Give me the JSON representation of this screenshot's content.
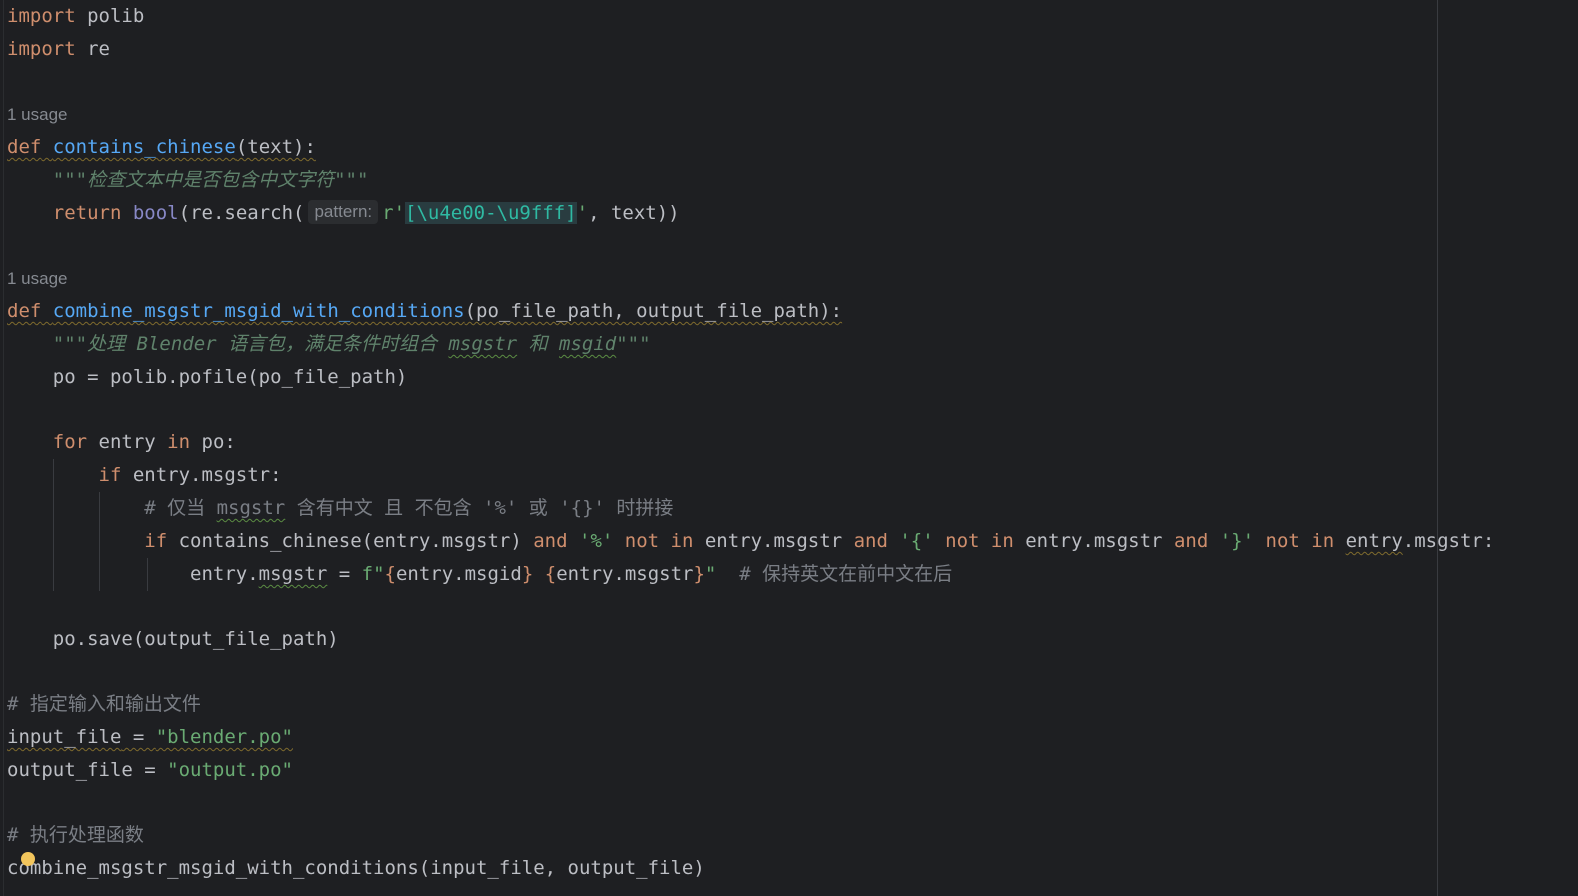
{
  "editor": {
    "lines": {
      "l1": {
        "kw": "import",
        "rest": " polib"
      },
      "l2": {
        "kw": "import",
        "rest": " re"
      },
      "usage1": "1 usage",
      "l5": {
        "kw": "def",
        "name": "contains_chinese",
        "rest": "(text):"
      },
      "l6": {
        "doc": "\"\"\"检查文本中是否包含中文字符\"\"\""
      },
      "l7": {
        "kw": "return",
        "bi": "bool",
        "pre": "(re.search(",
        "hint": "pattern:",
        "str_open": "r'",
        "esc": "[\\u4e00-\\u9fff]",
        "str_close": "'",
        "rest": ", text))"
      },
      "usage2": "1 usage",
      "l10": {
        "kw": "def",
        "name": "combine_msgstr_msgid_with_conditions",
        "rest": "(po_file_path, output_file_path):"
      },
      "l11": {
        "doc_a": "\"\"\"处理 Blender 语言包，满足条件时组合 ",
        "t1": "msgstr",
        "doc_b": " 和 ",
        "t2": "msgid",
        "doc_c": "\"\"\""
      },
      "l12": "po = polib.pofile(po_file_path)",
      "l14": {
        "kw": "for",
        "a": " entry ",
        "kw2": "in",
        "b": " po:"
      },
      "l15": {
        "kw": "if",
        "rest": " entry.msgstr:"
      },
      "l16": {
        "a": "# 仅当 ",
        "t": "msgstr",
        "b": " 含有中文 且 不包含 '%' 或 '{}' 时拼接"
      },
      "l17": {
        "kw": "if",
        "c1": " contains_chinese(entry.msgstr) ",
        "and1": "and",
        "s1": "'%'",
        "notin1": "not in",
        "c2": " entry.msgstr ",
        "and2": "and",
        "s2": "'{'",
        "notin2": "not in",
        "c3": " entry.msgstr ",
        "and3": "and",
        "s3": "'}'",
        "notin3": "not in",
        "c4a": "entry",
        "c4b": ".msgstr:"
      },
      "l18": {
        "a": "entry.",
        "t": "msgstr",
        "b": " = ",
        "fq": "f\"",
        "i1": "{entry.msgid}",
        "sp": " ",
        "i2": "{entry.msgstr}",
        "fe": "\"",
        "cmt": "  # 保持英文在前中文在后"
      },
      "l20": "po.save(output_file_path)",
      "l22": "# 指定输入和输出文件",
      "l23": {
        "name": "input_file",
        "eq": " = ",
        "str": "\"blender.po\""
      },
      "l24": {
        "a": "output_file = ",
        "str": "\"output.po\""
      },
      "l26": "# 执行处理函数",
      "l27": "combine_msgstr_msgid_with_conditions(input_file, output_file)"
    }
  },
  "colors": {
    "background": "#1e1f22",
    "keyword": "#cf8e6d",
    "function": "#56a8f5",
    "string": "#6aab73",
    "docstring": "#5f826b",
    "comment": "#7a7e85",
    "text": "#bcbec4"
  },
  "icons": {
    "intention": "lightbulb-icon"
  }
}
